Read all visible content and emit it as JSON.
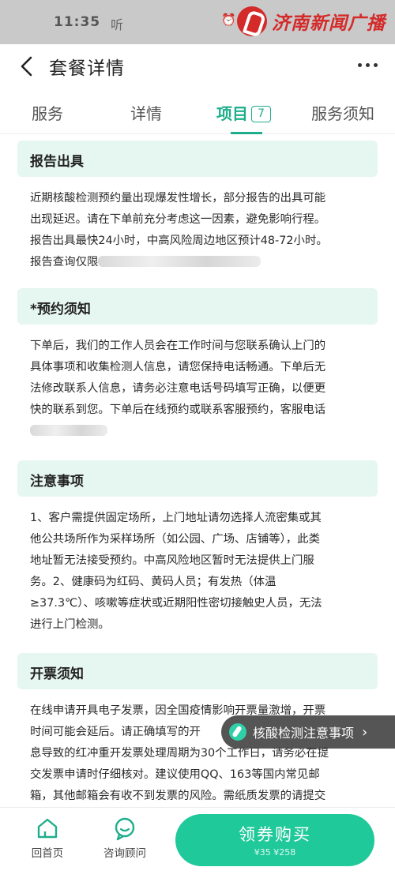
{
  "status_bar": {
    "time": "11:35",
    "extra": "听",
    "watermark": "济南新闻广播"
  },
  "header": {
    "title": "套餐详情"
  },
  "tabs": [
    {
      "label": "服务"
    },
    {
      "label": "详情"
    },
    {
      "label": "项目",
      "badge": "7"
    },
    {
      "label": "服务须知"
    }
  ],
  "sections": {
    "report": {
      "title": "报告出具",
      "p1": "近期核酸检测预约量出现爆发性增长，部分报告的出具可能",
      "p2": "出现延迟。请在下单前充分考虑这一因素，避免影响行程。",
      "p3": "报告出具最快24小时，中高风险周边地区预计48-72小时。",
      "p4": "报告查询仅限"
    },
    "booking": {
      "title": "*预约须知",
      "p1": "下单后，我们的工作人员会在工作时间与您联系确认上门的",
      "p2": "具体事项和收集检测人信息，请您保持电话畅通。下单后无",
      "p3": "法修改联系人信息，请务必注意电话号码填写正确，以便更",
      "p4": "快的联系到您。下单后在线预约或联系客服预约，客服电话"
    },
    "notice": {
      "title": "注意事项",
      "p1": "1、客户需提供固定场所，上门地址请勿选择人流密集或其",
      "p2": "他公共场所作为采样场所（如公园、广场、店铺等），此类",
      "p3": "地址暂无法接受预约。中高风险地区暂时无法提供上门服",
      "p4": "务。2、健康码为红码、黄码人员；有发热（体温",
      "p5": "≥37.3℃）、咳嗽等症状或近期阳性密切接触史人员，无法",
      "p6": "进行上门检测。"
    },
    "invoice": {
      "title": "开票须知",
      "p1": "在线申请开具电子发票，因全国疫情影响开票量激增，开票",
      "p2": "时间可能会延后。请正确填写的开",
      "p3": "息导致的红冲重开发票处理周期为30个工作日，请务必在提",
      "p4": "交发票申请时仔细核对。建议使用QQ、163等国内常见邮",
      "p5": "箱，其他邮箱会有收不到发票的风险。需纸质发票的请提交"
    }
  },
  "floating": {
    "label": "核酸检测注意事项",
    "chevron": "›"
  },
  "bottom_bar": {
    "home_label": "回首页",
    "consult_label": "咨询顾问",
    "buy_label": "领券购买",
    "buy_sub": "¥35 ¥258"
  },
  "colors": {
    "accent": "#1fae8b",
    "button": "#20c99a",
    "section_bg": "#e6f6f1"
  }
}
